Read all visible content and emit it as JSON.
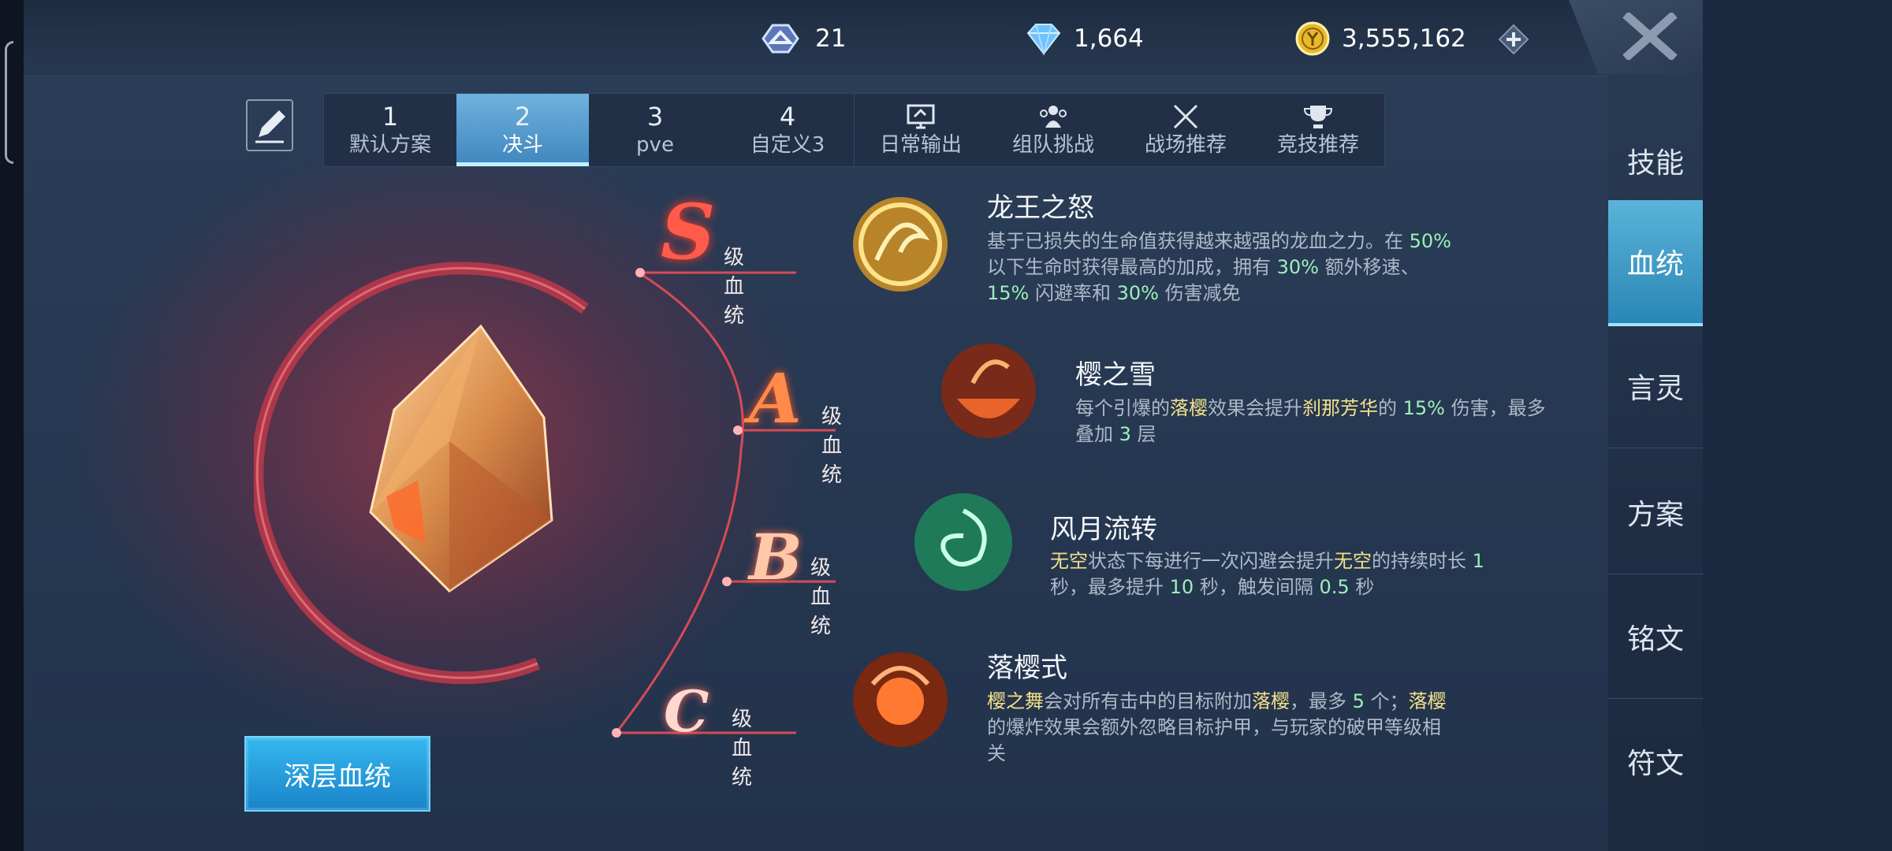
{
  "currencies": {
    "tickets": "21",
    "diamonds": "1,664",
    "coins": "3,555,162"
  },
  "plan_tabs": [
    {
      "num": "1",
      "label": "默认方案"
    },
    {
      "num": "2",
      "label": "决斗"
    },
    {
      "num": "3",
      "label": "pve"
    },
    {
      "num": "4",
      "label": "自定义3"
    }
  ],
  "recommend_tabs": [
    {
      "label": "日常输出",
      "icon": "monitor-icon"
    },
    {
      "label": "组队挑战",
      "icon": "team-icon"
    },
    {
      "label": "战场推荐",
      "icon": "crossed-swords-icon"
    },
    {
      "label": "竞技推荐",
      "icon": "trophy-icon"
    }
  ],
  "side_nav": [
    "技能",
    "血统",
    "言灵",
    "方案",
    "铭文",
    "符文"
  ],
  "tiers": [
    {
      "rank": "S",
      "rank_label": "级血统",
      "name": "龙王之怒",
      "desc": [
        {
          "t": "基于已损失的生命值获得越来越强的龙血之力。在 "
        },
        {
          "t": "50%",
          "c": "g"
        },
        {
          "t": " 以下生命时获得最高的加成，拥有 "
        },
        {
          "t": "30%",
          "c": "g"
        },
        {
          "t": " 额外移速、 "
        },
        {
          "t": "15%",
          "c": "g"
        },
        {
          "t": " 闪避率和 "
        },
        {
          "t": "30%",
          "c": "g"
        },
        {
          "t": " 伤害减免"
        }
      ]
    },
    {
      "rank": "A",
      "rank_label": "级血统",
      "name": "樱之雪",
      "desc": [
        {
          "t": "每个引爆的"
        },
        {
          "t": "落樱",
          "c": "y"
        },
        {
          "t": "效果会提升"
        },
        {
          "t": "刹那芳华",
          "c": "y"
        },
        {
          "t": "的 "
        },
        {
          "t": "15%",
          "c": "g"
        },
        {
          "t": " 伤害，最多叠加 "
        },
        {
          "t": "3",
          "c": "g"
        },
        {
          "t": " 层"
        }
      ]
    },
    {
      "rank": "B",
      "rank_label": "级血统",
      "name": "风月流转",
      "desc": [
        {
          "t": "无空",
          "c": "y"
        },
        {
          "t": "状态下每进行一次闪避会提升"
        },
        {
          "t": "无空",
          "c": "y"
        },
        {
          "t": "的持续时长 "
        },
        {
          "t": "1",
          "c": "g"
        },
        {
          "t": " 秒，最多提升 "
        },
        {
          "t": "10",
          "c": "g"
        },
        {
          "t": " 秒，触发间隔 "
        },
        {
          "t": "0.5",
          "c": "g"
        },
        {
          "t": " 秒"
        }
      ]
    },
    {
      "rank": "C",
      "rank_label": "级血统",
      "name": "落樱式",
      "desc": [
        {
          "t": "樱之舞",
          "c": "y"
        },
        {
          "t": "会对所有击中的目标附加"
        },
        {
          "t": "落樱",
          "c": "y"
        },
        {
          "t": "，最多 "
        },
        {
          "t": "5",
          "c": "g"
        },
        {
          "t": " 个；"
        },
        {
          "t": "落樱",
          "c": "y"
        },
        {
          "t": "的爆炸效果会额外忽略目标护甲，与玩家的破甲等级相关"
        }
      ]
    }
  ],
  "deep_button": "深层血统"
}
